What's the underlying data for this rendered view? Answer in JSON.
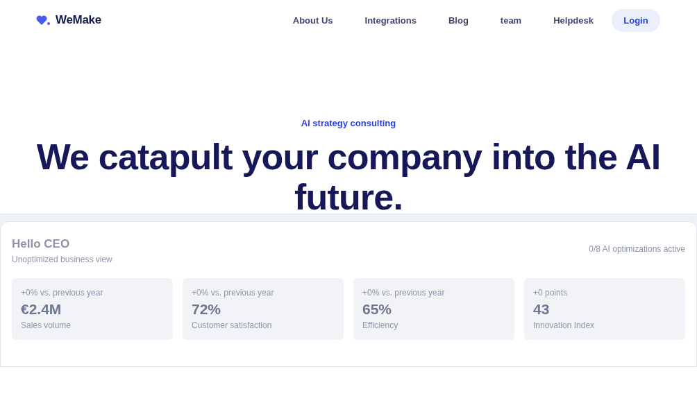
{
  "brand": {
    "name": "WeMake"
  },
  "nav": {
    "links": [
      "About Us",
      "Integrations",
      "Blog",
      "team",
      "Helpdesk"
    ],
    "login": "Login"
  },
  "hero": {
    "eyebrow": "AI strategy consulting",
    "headline_lines": [
      "We catapult your company into the AI",
      "future."
    ]
  },
  "dashboard": {
    "greeting": "Hello CEO",
    "subtitle": "Unoptimized business view",
    "status": "0/8 AI optimizations active",
    "metrics": [
      {
        "change": "+0% vs. previous year",
        "value": "€2.4M",
        "label": "Sales volume"
      },
      {
        "change": "+0% vs. previous year",
        "value": "72%",
        "label": "Customer satisfaction"
      },
      {
        "change": "+0% vs. previous year",
        "value": "65%",
        "label": "Efficiency"
      },
      {
        "change": "+0 points",
        "value": "43",
        "label": "Innovation Index"
      }
    ]
  }
}
